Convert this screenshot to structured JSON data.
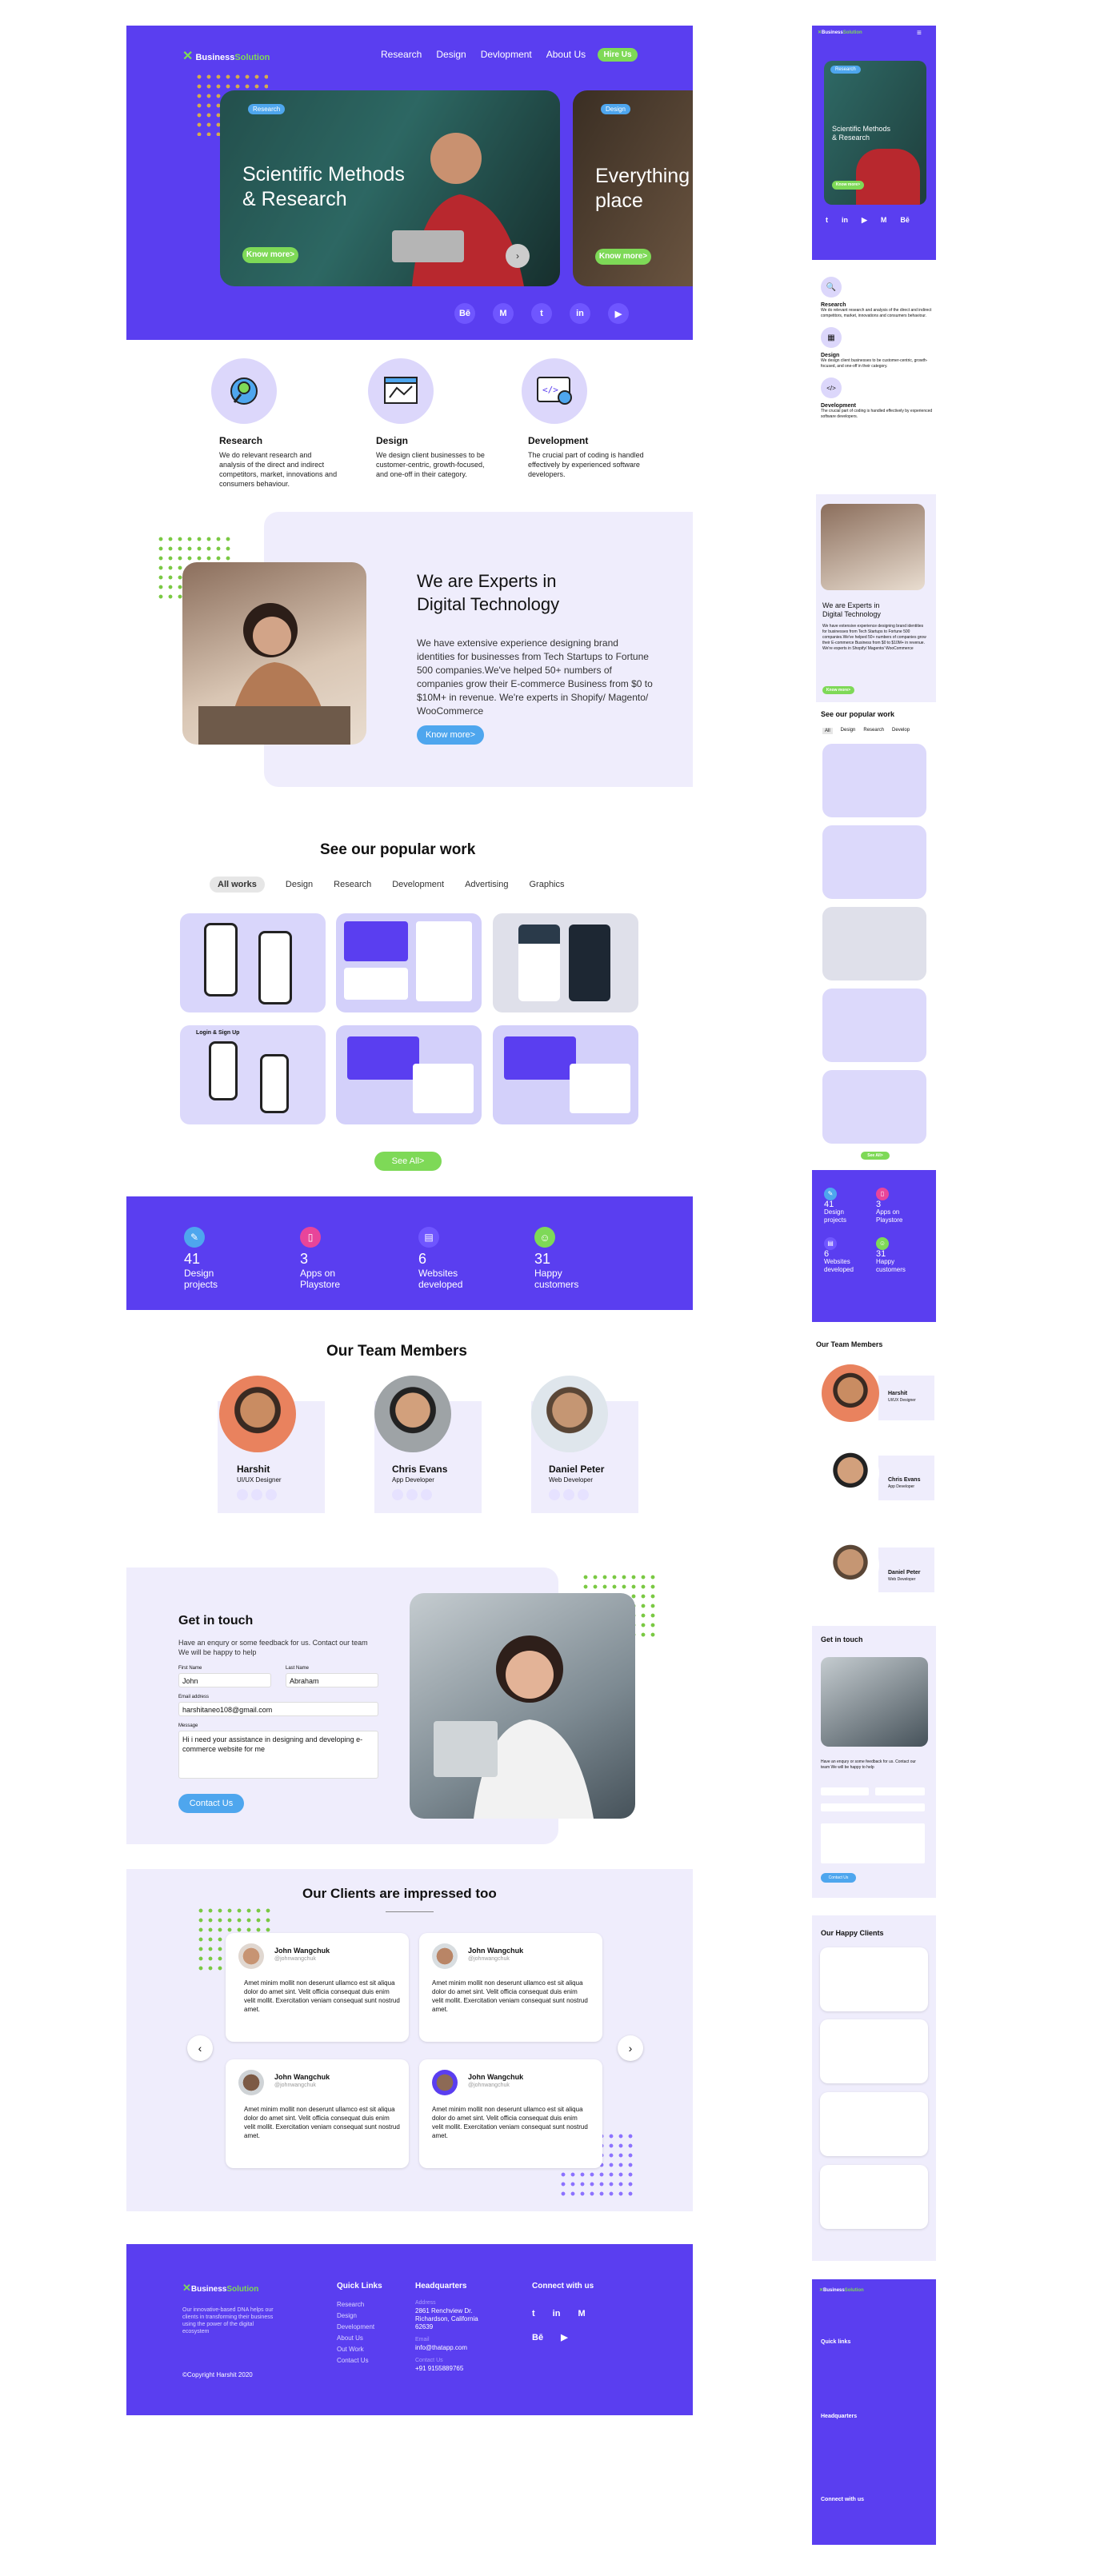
{
  "brand": {
    "prefix": "Business",
    "suffix": "Solution"
  },
  "nav": {
    "items": [
      "Research",
      "Design",
      "Devlopment",
      "About Us"
    ],
    "cta": "Hire Us"
  },
  "hero": {
    "slides": [
      {
        "tag": "Research",
        "title1": "Scientific Methods",
        "title2": "& Research",
        "btn": "Know more>"
      },
      {
        "tag": "Design",
        "title1": "Everything",
        "title2": "place",
        "btn": "Know more>"
      }
    ],
    "social": [
      "Bē",
      "M",
      "t",
      "in",
      "▶"
    ]
  },
  "services": [
    {
      "title": "Research",
      "desc": "We do relevant research and analysis of the direct and indirect competitors, market, innovations and consumers behaviour."
    },
    {
      "title": "Design",
      "desc": "We design client businesses to be customer-centric, growth-focused, and one-off in their category."
    },
    {
      "title": "Development",
      "desc": "The crucial part of coding is handled effectively by experienced software developers."
    }
  ],
  "experts": {
    "title1": "We are Experts in",
    "title2": "Digital Technology",
    "body": "We have extensive experience designing brand identities for businesses from Tech Startups to Fortune 500 companies.We've helped 50+ numbers of companies grow their E-commerce Business from $0 to $10M+ in revenue. We're experts in Shopify/ Magento/ WooCommerce",
    "btn": "Know more>"
  },
  "work": {
    "title": "See our popular work",
    "tabs": [
      "All works",
      "Design",
      "Research",
      "Development",
      "Advertising",
      "Graphics"
    ],
    "see_all": "See All>",
    "login_label": "Login & Sign Up"
  },
  "stats": [
    {
      "num": "41",
      "l1": "Design",
      "l2": "projects",
      "color": "#4ea6ee"
    },
    {
      "num": "3",
      "l1": "Apps on",
      "l2": "Playstore",
      "color": "#e8459a"
    },
    {
      "num": "6",
      "l1": "Websites",
      "l2": "developed",
      "color": "#6f56ff"
    },
    {
      "num": "31",
      "l1": "Happy",
      "l2": "customers",
      "color": "#7ed957"
    }
  ],
  "team": {
    "title": "Our Team Members",
    "members": [
      {
        "name": "Harshit",
        "role": "UI/UX Designer"
      },
      {
        "name": "Chris Evans",
        "role": "App Developer"
      },
      {
        "name": "Daniel Peter",
        "role": "Web Developer"
      }
    ]
  },
  "contact": {
    "title": "Get in touch",
    "sub": "Have an enqury or some feedback for us. Contact our team We will be happy to help",
    "first_label": "First Name",
    "first": "John",
    "last_label": "Last Name",
    "last": "Abraham",
    "email_label": "Email address",
    "email": "harshitaneo108@gmail.com",
    "msg_label": "Message",
    "msg": "Hi i need your assistance in designing and developing e-commerce website for me",
    "btn": "Contact Us"
  },
  "clients": {
    "title": "Our Clients are impressed too",
    "reviews": [
      {
        "name": "John Wangchuk",
        "handle": "@johnwangchuk",
        "text": "Amet minim mollit non deserunt ullamco est sit aliqua dolor do amet sint. Velit officia consequat duis enim velit mollit. Exercitation veniam consequat sunt nostrud amet."
      },
      {
        "name": "John Wangchuk",
        "handle": "@johnwangchuk",
        "text": "Amet minim mollit non deserunt ullamco est sit aliqua dolor do amet sint. Velit officia consequat duis enim velit mollit. Exercitation veniam consequat sunt nostrud amet."
      },
      {
        "name": "John Wangchuk",
        "handle": "@johnwangchuk",
        "text": "Amet minim mollit non deserunt ullamco est sit aliqua dolor do amet sint. Velit officia consequat duis enim velit mollit. Exercitation veniam consequat sunt nostrud amet."
      },
      {
        "name": "John Wangchuk",
        "handle": "@johnwangchuk",
        "text": "Amet minim mollit non deserunt ullamco est sit aliqua dolor do amet sint. Velit officia consequat duis enim velit mollit. Exercitation veniam consequat sunt nostrud amet."
      }
    ]
  },
  "footer": {
    "about": "Our innovative-based DNA helps our clients in transforming their business using the power of the digital ecosystem",
    "copyright": "©Copyright Harshit 2020",
    "quick_title": "Quick Links",
    "quick": [
      "Research",
      "Design",
      "Development",
      "About Us",
      "Out Work",
      "Contact Us"
    ],
    "hq_title": "Headquarters",
    "addr_label": "Address",
    "addr": "2861 Renchview Dr. Richardson, California 62639",
    "email_label": "Email",
    "email": "info@thatapp.com",
    "phone_label": "Contact Us",
    "phone": "+91 9155889765",
    "connect_title": "Connect with us"
  },
  "mobile": {
    "hero_title1": "Scientific Methods",
    "hero_title2": "& Research",
    "work_title": "See our popular work",
    "work_tabs": [
      "All",
      "Design",
      "Research",
      "Develop"
    ],
    "happy_title": "Our Happy Clients",
    "team_title": "Our Team Members",
    "contact_title": "Get in touch",
    "quick_title": "Quick links",
    "hq_title": "Headquarters",
    "connect_title": "Connect with us"
  },
  "colors": {
    "purple": "#5a3ef0",
    "lavender": "#efedfc",
    "green": "#7ed957",
    "blue": "#4ea6ee"
  }
}
